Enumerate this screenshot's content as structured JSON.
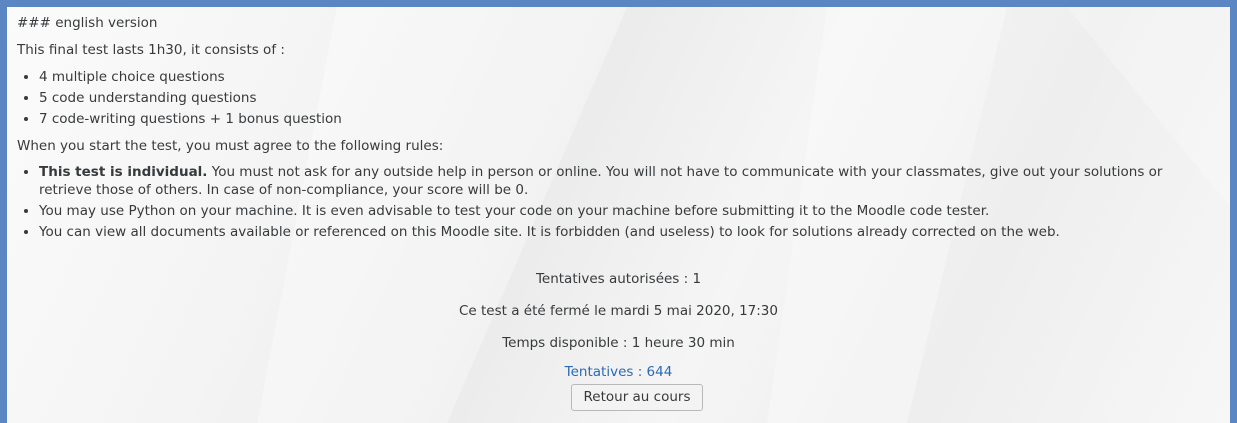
{
  "intro_block": {
    "heading": "### english version",
    "duration_text": "This final test lasts 1h30, it consists of :",
    "components": [
      "4 multiple choice questions",
      "5 code understanding questions",
      "7 code-writing questions + 1 bonus question"
    ],
    "rules_intro": "When you start the test, you must agree to the following rules:",
    "rules": [
      {
        "bold": "This test is individual.",
        "text": " You must not ask for any outside help in person or online. You will not have to communicate with your classmates, give out your solutions or retrieve those of others. In case of non-compliance, your score will be 0."
      },
      {
        "bold": "",
        "text": "You may use Python on your machine. It is even advisable to test your code on your machine before submitting it to the Moodle code tester."
      },
      {
        "bold": "",
        "text": "You can view all documents available or referenced on this Moodle site. It is forbidden (and useless) to look for solutions already corrected on the web."
      }
    ]
  },
  "quiz_info": {
    "attempts_allowed": "Tentatives autorisées : 1",
    "closed_date": "Ce test a été fermé le mardi 5 mai 2020, 17:30",
    "time_limit": "Temps disponible : 1 heure 30 min",
    "attempts_link": "Tentatives : 644",
    "back_button": "Retour au cours"
  },
  "colors": {
    "frame_border": "#5b86c4",
    "link": "#2a6ab5",
    "text": "#373a3c"
  }
}
